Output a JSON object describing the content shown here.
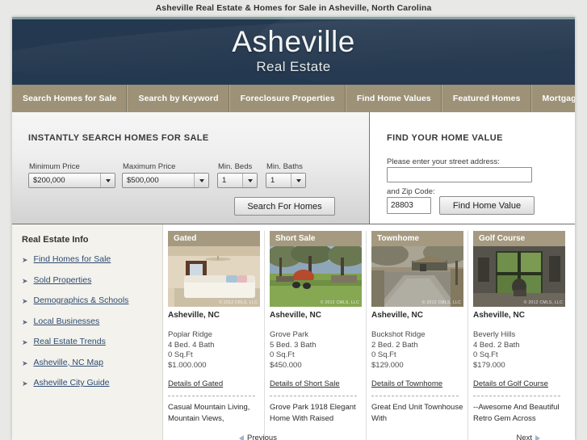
{
  "page_title": "Asheville Real Estate & Homes for Sale in Asheville, North Carolina",
  "banner": {
    "logo_main": "Asheville",
    "logo_sub": "Real Estate"
  },
  "nav": {
    "items": [
      {
        "label": "Search Homes for Sale"
      },
      {
        "label": "Search by Keyword"
      },
      {
        "label": "Foreclosure Properties"
      },
      {
        "label": "Find Home Values"
      },
      {
        "label": "Featured Homes"
      },
      {
        "label": "Mortgage Info"
      }
    ]
  },
  "search_panel": {
    "title": "INSTANTLY SEARCH HOMES FOR SALE",
    "min_price_label": "Minimum Price",
    "min_price_value": "$200,000",
    "max_price_label": "Maximum Price",
    "max_price_value": "$500,000",
    "min_beds_label": "Min. Beds",
    "min_beds_value": "1",
    "min_baths_label": "Min. Baths",
    "min_baths_value": "1",
    "submit_label": "Search For Homes"
  },
  "value_panel": {
    "title": "FIND YOUR HOME VALUE",
    "address_label": "Please enter your street address:",
    "address_value": "",
    "address_placeholder": "",
    "zip_label": "and Zip Code:",
    "zip_value": "28803",
    "submit_label": "Find Home Value"
  },
  "sidebar": {
    "title": "Real Estate Info",
    "arrow": "➤",
    "items": [
      {
        "label": "Find Homes for Sale"
      },
      {
        "label": "Sold Properties"
      },
      {
        "label": "Demographics & Schools"
      },
      {
        "label": "Local Businesses"
      },
      {
        "label": "Real Estate Trends"
      },
      {
        "label": "Asheville, NC Map"
      },
      {
        "label": "Asheville City Guide"
      }
    ]
  },
  "listings": [
    {
      "badge": "Gated",
      "city": "Asheville, NC",
      "subdivision": "Poplar Ridge",
      "beds_baths": "4 Bed. 4 Bath",
      "sqft": "0 Sq.Ft",
      "price": "$1.000.000",
      "details_link": "Details of Gated",
      "description": "Casual Mountain Living, Mountain Views,",
      "watermark": "© 2012 CRLS, LLC"
    },
    {
      "badge": "Short Sale",
      "city": "Asheville, NC",
      "subdivision": "Grove Park",
      "beds_baths": "5 Bed. 3 Bath",
      "sqft": "0 Sq.Ft",
      "price": "$450.000",
      "details_link": "Details of Short Sale",
      "description": "Grove Park 1918 Elegant Home With Raised",
      "watermark": "© 2012 CMLS, LLC"
    },
    {
      "badge": "Townhome",
      "city": "Asheville, NC",
      "subdivision": "Buckshot Ridge",
      "beds_baths": "2 Bed. 2 Bath",
      "sqft": "0 Sq.Ft",
      "price": "$129.000",
      "details_link": "Details of Townhome",
      "description": "Great End Unit Townhouse With",
      "watermark": "© 2012 CMLS, LLC"
    },
    {
      "badge": "Golf Course",
      "city": "Asheville, NC",
      "subdivision": "Beverly Hills",
      "beds_baths": "4 Bed. 2 Bath",
      "sqft": "0 Sq.Ft",
      "price": "$179.000",
      "details_link": "Details of Golf Course",
      "description": "--Awesome And Beautiful Retro Gem Across",
      "watermark": "© 2012 CMLS, LLC"
    }
  ],
  "pagination": {
    "previous": "Previous",
    "next": "Next"
  },
  "colors": {
    "banner_navy": "#24384f",
    "banner_top_strip": "#7f9d9c",
    "nav_tan": "#9d9177",
    "badge_tan": "#a59a80",
    "link_blue": "#2e4a72",
    "sidebar_bg": "#f3f2ec"
  }
}
